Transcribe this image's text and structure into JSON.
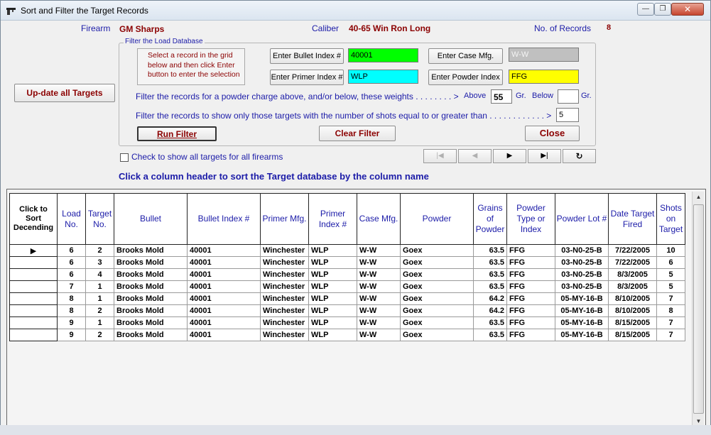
{
  "window": {
    "title": "Sort and Filter the Target Records",
    "min_glyph": "—",
    "max_glyph": "❐",
    "close_glyph": "✕"
  },
  "header": {
    "firearm_label": "Firearm",
    "firearm_value": "GM Sharps",
    "caliber_label": "Caliber",
    "caliber_value": "40-65 Win Ron Long",
    "records_label": "No. of Records",
    "records_value": "8"
  },
  "update_button": "Up-date all Targets",
  "filter_group": {
    "legend": "Filter the Load Database",
    "instruction": "Select a record in the grid below and then click Enter button to enter the selection",
    "bullet_button": "Enter Bullet Index #",
    "bullet_value": "40001",
    "primer_button": "Enter Primer Index #",
    "primer_value": "WLP",
    "case_button": "Enter Case Mfg.",
    "case_value": "W-W",
    "powder_button": "Enter Powder Index",
    "powder_value": "FFG",
    "charge_text": "Filter the records for a powder charge above, and/or below, these weights . . . . . . . . >",
    "above_label": "Above",
    "above_value": "55",
    "gr_label_1": "Gr.",
    "below_label": "Below",
    "below_value": "",
    "gr_label_2": "Gr.",
    "shots_text": "Filter the records to show only those targets with the number of shots equal to or greater than . . . . . . . . . . . . >",
    "shots_value": "5",
    "run_button": "Run Filter",
    "clear_button": "Clear Filter",
    "close_button": "Close"
  },
  "nav": {
    "first": "|◀",
    "prev": "◀",
    "next": "▶",
    "last": "▶|",
    "refresh": "↻"
  },
  "checkbox_label": "Check to show all targets for all firearms",
  "sort_hint": "Click a column header to sort the Target database by the column name",
  "grid": {
    "corner": "Click to Sort Decending",
    "columns": [
      "Load No.",
      "Target No.",
      "Bullet",
      "Bullet Index #",
      "Primer Mfg.",
      "Primer Index #",
      "Case Mfg.",
      "Powder",
      "Grains of Powder",
      "Powder Type or Index",
      "Powder Lot #",
      "Date Target Fired",
      "Shots on Target"
    ],
    "selected_marker": "▶",
    "rows": [
      [
        "6",
        "2",
        "Brooks Mold",
        "40001",
        "Winchester",
        "WLP",
        "W-W",
        "Goex",
        "63.5",
        "FFG",
        "03-N0-25-B",
        "7/22/2005",
        "10"
      ],
      [
        "6",
        "3",
        "Brooks Mold",
        "40001",
        "Winchester",
        "WLP",
        "W-W",
        "Goex",
        "63.5",
        "FFG",
        "03-N0-25-B",
        "7/22/2005",
        "6"
      ],
      [
        "6",
        "4",
        "Brooks Mold",
        "40001",
        "Winchester",
        "WLP",
        "W-W",
        "Goex",
        "63.5",
        "FFG",
        "03-N0-25-B",
        "8/3/2005",
        "5"
      ],
      [
        "7",
        "1",
        "Brooks Mold",
        "40001",
        "Winchester",
        "WLP",
        "W-W",
        "Goex",
        "63.5",
        "FFG",
        "03-N0-25-B",
        "8/3/2005",
        "5"
      ],
      [
        "8",
        "1",
        "Brooks Mold",
        "40001",
        "Winchester",
        "WLP",
        "W-W",
        "Goex",
        "64.2",
        "FFG",
        "05-MY-16-B",
        "8/10/2005",
        "7"
      ],
      [
        "8",
        "2",
        "Brooks Mold",
        "40001",
        "Winchester",
        "WLP",
        "W-W",
        "Goex",
        "64.2",
        "FFG",
        "05-MY-16-B",
        "8/10/2005",
        "8"
      ],
      [
        "9",
        "1",
        "Brooks Mold",
        "40001",
        "Winchester",
        "WLP",
        "W-W",
        "Goex",
        "63.5",
        "FFG",
        "05-MY-16-B",
        "8/15/2005",
        "7"
      ],
      [
        "9",
        "2",
        "Brooks Mold",
        "40001",
        "Winchester",
        "WLP",
        "W-W",
        "Goex",
        "63.5",
        "FFG",
        "05-MY-16-B",
        "8/15/2005",
        "7"
      ]
    ]
  },
  "colors": {
    "label_blue": "#1c1ca8",
    "value_red": "#8b0000",
    "bullet_field": "#00ff00",
    "primer_field": "#00ffff",
    "case_field": "#c0c0c0",
    "powder_field": "#ffff00"
  },
  "icons": {
    "app": "gun-icon",
    "scroll_up": "scroll-up-arrow-icon",
    "scroll_down": "scroll-down-arrow-icon"
  }
}
